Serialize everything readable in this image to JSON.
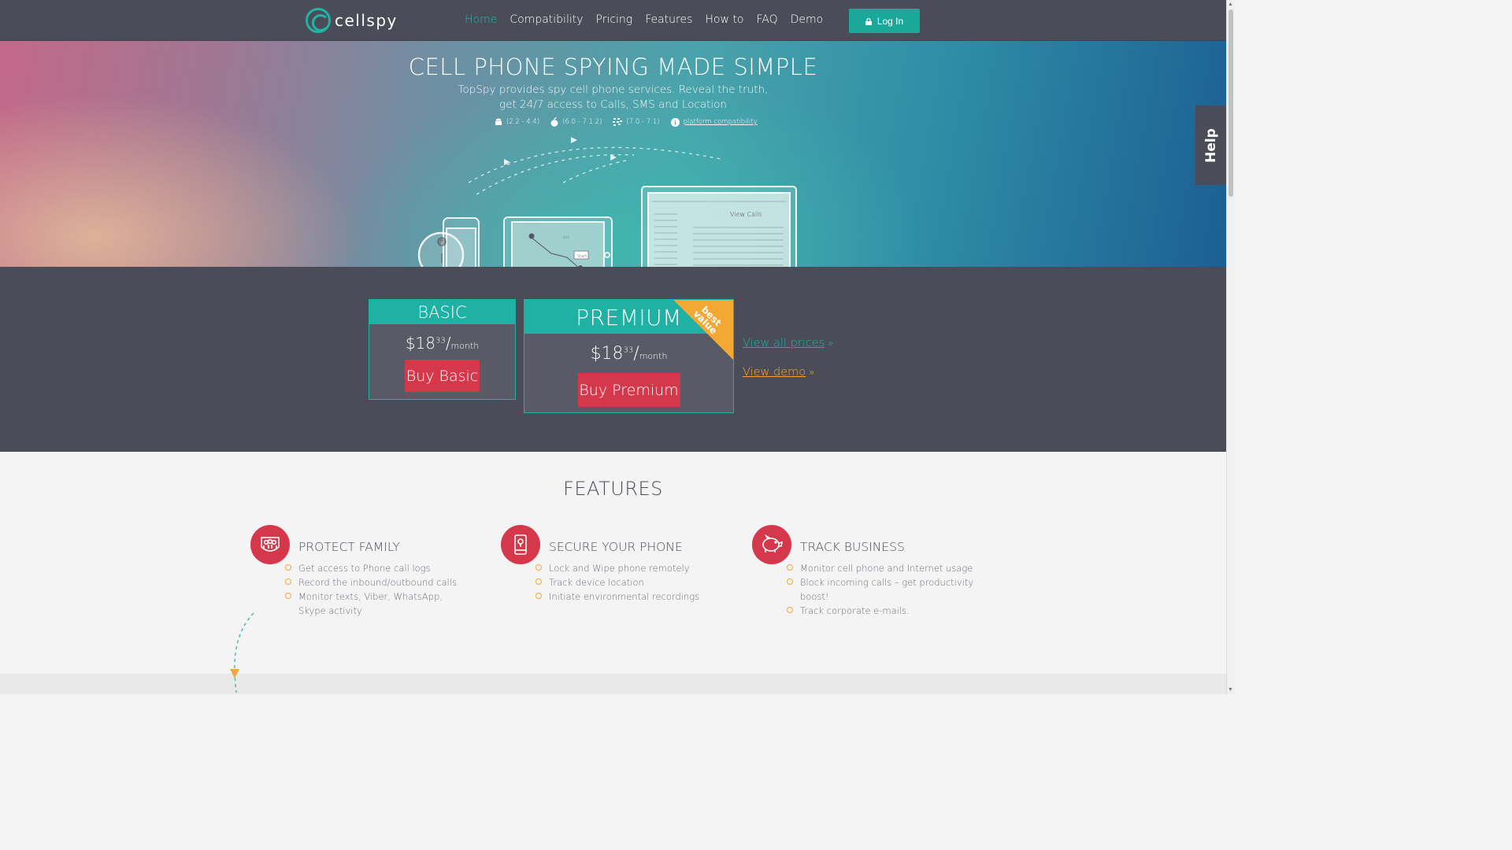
{
  "header": {
    "logo_text": "cellspy",
    "nav": [
      "Home",
      "Compatibility",
      "Pricing",
      "Features",
      "How to",
      "FAQ",
      "Demo"
    ],
    "active_nav": "Home",
    "login_label": "Log In"
  },
  "hero": {
    "title": "CELL PHONE SPYING MADE SIMPLE",
    "subtitle_line1": "TopSpy provides spy cell phone services. Reveal the truth,",
    "subtitle_line2": "get 24/7 access to Calls, SMS and Location",
    "platforms": [
      {
        "icon": "android-icon",
        "range": "(2.2 - 4.4)"
      },
      {
        "icon": "apple-icon",
        "range": "(6.0 - 7.1.2)"
      },
      {
        "icon": "blackberry-icon",
        "range": "(7.0 - 7.1)"
      }
    ],
    "compat_link": "platform compatibility",
    "illustration": {
      "map_label": "Start",
      "map_small": "023",
      "laptop_title": "View Calls"
    }
  },
  "help_tab": "Help",
  "pricing": {
    "basic": {
      "name": "BASIC",
      "price_whole": "$18",
      "price_cents": "33",
      "per": "/",
      "unit": "month",
      "button": "Buy Basic"
    },
    "premium": {
      "name": "PREMIUM",
      "price_whole": "$18",
      "price_cents": "33",
      "per": "/",
      "unit": "month",
      "button": "Buy Premium",
      "ribbon_line1": "best",
      "ribbon_line2": "value"
    },
    "links": {
      "all_prices": "View all prices",
      "demo": "View demo"
    }
  },
  "features": {
    "title": "FEATURES",
    "items": [
      {
        "icon": "family-icon",
        "title": "PROTECT FAMILY",
        "bullets": [
          "Get access to Phone call logs",
          "Record the inbound/outbound calls",
          "Monitor texts, Viber, WhatsApp, Skype activity"
        ]
      },
      {
        "icon": "phone-lock-icon",
        "title": "SECURE YOUR PHONE",
        "bullets": [
          "Lock and Wipe phone remotely",
          "Track device location",
          "Initiate environmental recordings"
        ]
      },
      {
        "icon": "piggy-bank-icon",
        "title": "TRACK BUSINESS",
        "bullets": [
          "Monitor cell phone and Internet usage",
          "Block incoming calls – get productivity boost!",
          "Track corporate e-mails."
        ]
      }
    ]
  },
  "colors": {
    "teal": "#1fb1a3",
    "red": "#d6384b",
    "orange": "#f2a833",
    "dark": "#4a4d57"
  }
}
